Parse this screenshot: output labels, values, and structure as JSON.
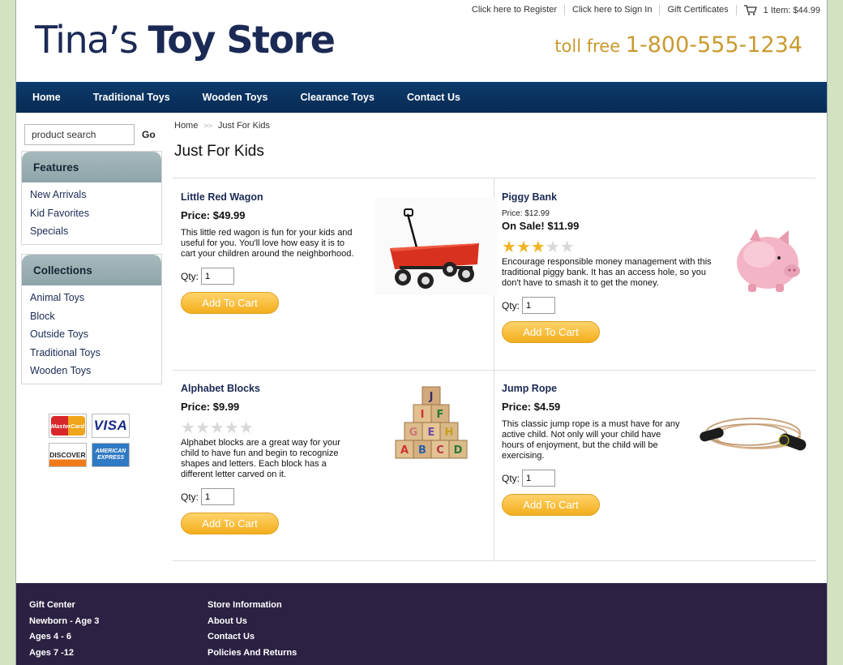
{
  "header": {
    "links": [
      "Click here to Register",
      "Click here to Sign In",
      "Gift Certificates"
    ],
    "cart_text": "1 Item: $44.99",
    "logo_light": "Tina’s ",
    "logo_bold": "Toy Store",
    "toll_label": "toll free ",
    "toll_number": "1-800-555-1234"
  },
  "nav": [
    "Home",
    "Traditional Toys",
    "Wooden Toys",
    "Clearance Toys",
    "Contact Us"
  ],
  "sidebar": {
    "search_placeholder": "product search",
    "go_label": "Go",
    "features": {
      "title": "Features",
      "items": [
        "New Arrivals",
        "Kid Favorites",
        "Specials"
      ]
    },
    "collections": {
      "title": "Collections",
      "items": [
        "Animal Toys",
        "Block",
        "Outside Toys",
        "Traditional Toys",
        "Wooden Toys"
      ]
    },
    "cards": {
      "mastercard": "MasterCard",
      "visa": "VISA",
      "discover": "DISCOVER",
      "amex": "AMERICAN EXPRESS"
    }
  },
  "breadcrumb": {
    "home": "Home",
    "current": "Just For Kids"
  },
  "page_title": "Just For Kids",
  "products": [
    {
      "name": "Little Red Wagon",
      "price": "Price: $49.99",
      "desc": "This little red wagon is fun for your kids and useful for you. You'll love how easy it is to cart your children around the neighborhood.",
      "qty_label": "Qty:",
      "qty": "1",
      "button": "Add To Cart"
    },
    {
      "name": "Piggy Bank",
      "price_small": "Price: $12.99",
      "sale": "On Sale! $11.99",
      "rating": 3,
      "desc": "Encourage responsible money management with this traditional piggy bank. It has an access hole, so you don't have to smash it to get the money.",
      "qty_label": "Qty:",
      "qty": "1",
      "button": "Add To Cart"
    },
    {
      "name": "Alphabet Blocks",
      "price": "Price: $9.99",
      "rating": 0,
      "desc": "Alphabet blocks are a great way for your child to have fun and begin to recognize shapes and letters. Each block has a different letter carved on it.",
      "qty_label": "Qty:",
      "qty": "1",
      "button": "Add To Cart"
    },
    {
      "name": "Jump Rope",
      "price": "Price: $4.59",
      "desc": "This classic jump rope is a must have for any active child. Not only will your child have hours of enjoyment, but the child will be exercising.",
      "qty_label": "Qty:",
      "qty": "1",
      "button": "Add To Cart"
    }
  ],
  "block_letters": [
    "J",
    "I",
    "F",
    "G",
    "E",
    "H",
    "A",
    "B",
    "C",
    "D"
  ],
  "footer": {
    "col1": [
      "Gift Center",
      "Newborn - Age 3",
      "Ages 4 - 6",
      "Ages 7 -12"
    ],
    "col2": [
      "Store Information",
      "About Us",
      "Contact Us",
      "Policies And Returns"
    ]
  },
  "colors": {
    "nav": "#0c3a6c",
    "footer": "#2c2142",
    "button": "#f3ae1c",
    "toll": "#c99a2e",
    "star": "#f2b324",
    "background": "#d3e3c2"
  }
}
